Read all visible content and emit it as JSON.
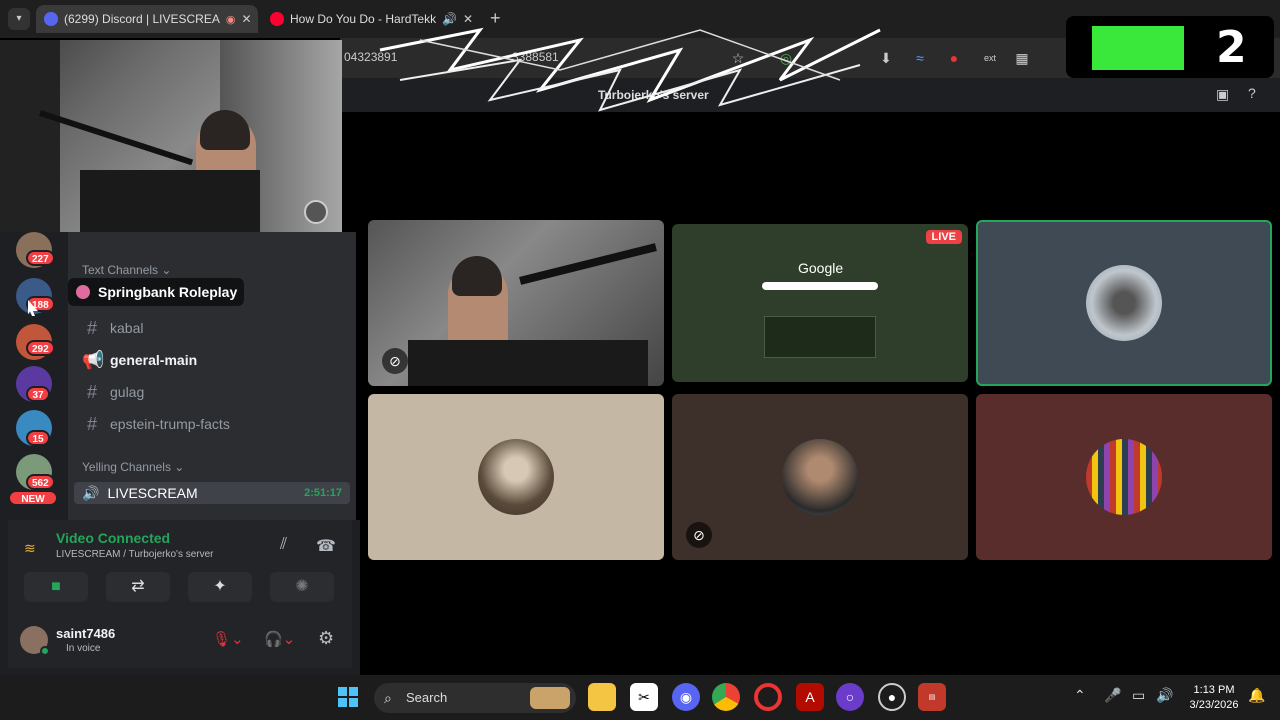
{
  "browser": {
    "tabs": [
      {
        "label": "(6299) Discord | LIVESCREA",
        "badge": "6k+"
      },
      {
        "label": "How Do You Do - HardTekk"
      }
    ],
    "new_tab": "+",
    "url_start": "04323891",
    "url_end": "3388581"
  },
  "overlay": {
    "logo_text": "2"
  },
  "discord": {
    "window_title": "Turbojerko's server",
    "servers": [
      {
        "badge": "227",
        "color": "#8a6f5a"
      },
      {
        "badge": "188",
        "color": "#3a5a8a"
      },
      {
        "badge": "292",
        "color": "#c2563a"
      },
      {
        "badge": "37",
        "color": "#5a3aa0"
      },
      {
        "badge": "15",
        "color": "#3a8ac2"
      },
      {
        "badge": "562",
        "color": "#7a9a7a"
      },
      {
        "badge": "NEW",
        "color": "#2b2d31"
      }
    ],
    "text_category": "Text Channels",
    "tooltip_server": "Springbank Roleplay",
    "text_channels": [
      {
        "name": "kabal",
        "bold": false
      },
      {
        "name": "general-main",
        "bold": true
      },
      {
        "name": "gulag",
        "bold": false
      },
      {
        "name": "epstein-trump-facts",
        "bold": false
      }
    ],
    "voice_category": "Yelling Channels",
    "voice_channel": {
      "name": "LIVESCREAM",
      "time": "2:51:17"
    },
    "rtc": {
      "status": "Video Connected",
      "location": "LIVESCREAM / Turbojerko's server"
    },
    "user": {
      "name": "saint7486",
      "status": "In voice"
    },
    "tiles": [
      {
        "type": "camera",
        "muted": true
      },
      {
        "type": "stream",
        "live_label": "LIVE",
        "stream_text": "Google"
      },
      {
        "type": "avatar",
        "color": "#3f4a54",
        "speaking": true
      },
      {
        "type": "avatar",
        "color": "#c4b8a4"
      },
      {
        "type": "avatar",
        "color": "#3d302b",
        "muted": true
      },
      {
        "type": "avatar",
        "color": "#5a2d2d"
      }
    ]
  },
  "taskbar": {
    "search_placeholder": "Search",
    "time": "1:13 PM",
    "date": "3/23/2026"
  },
  "colors": {
    "discord_green": "#23a55a",
    "live_red": "#ed4245",
    "logo_green": "#39e83a"
  }
}
